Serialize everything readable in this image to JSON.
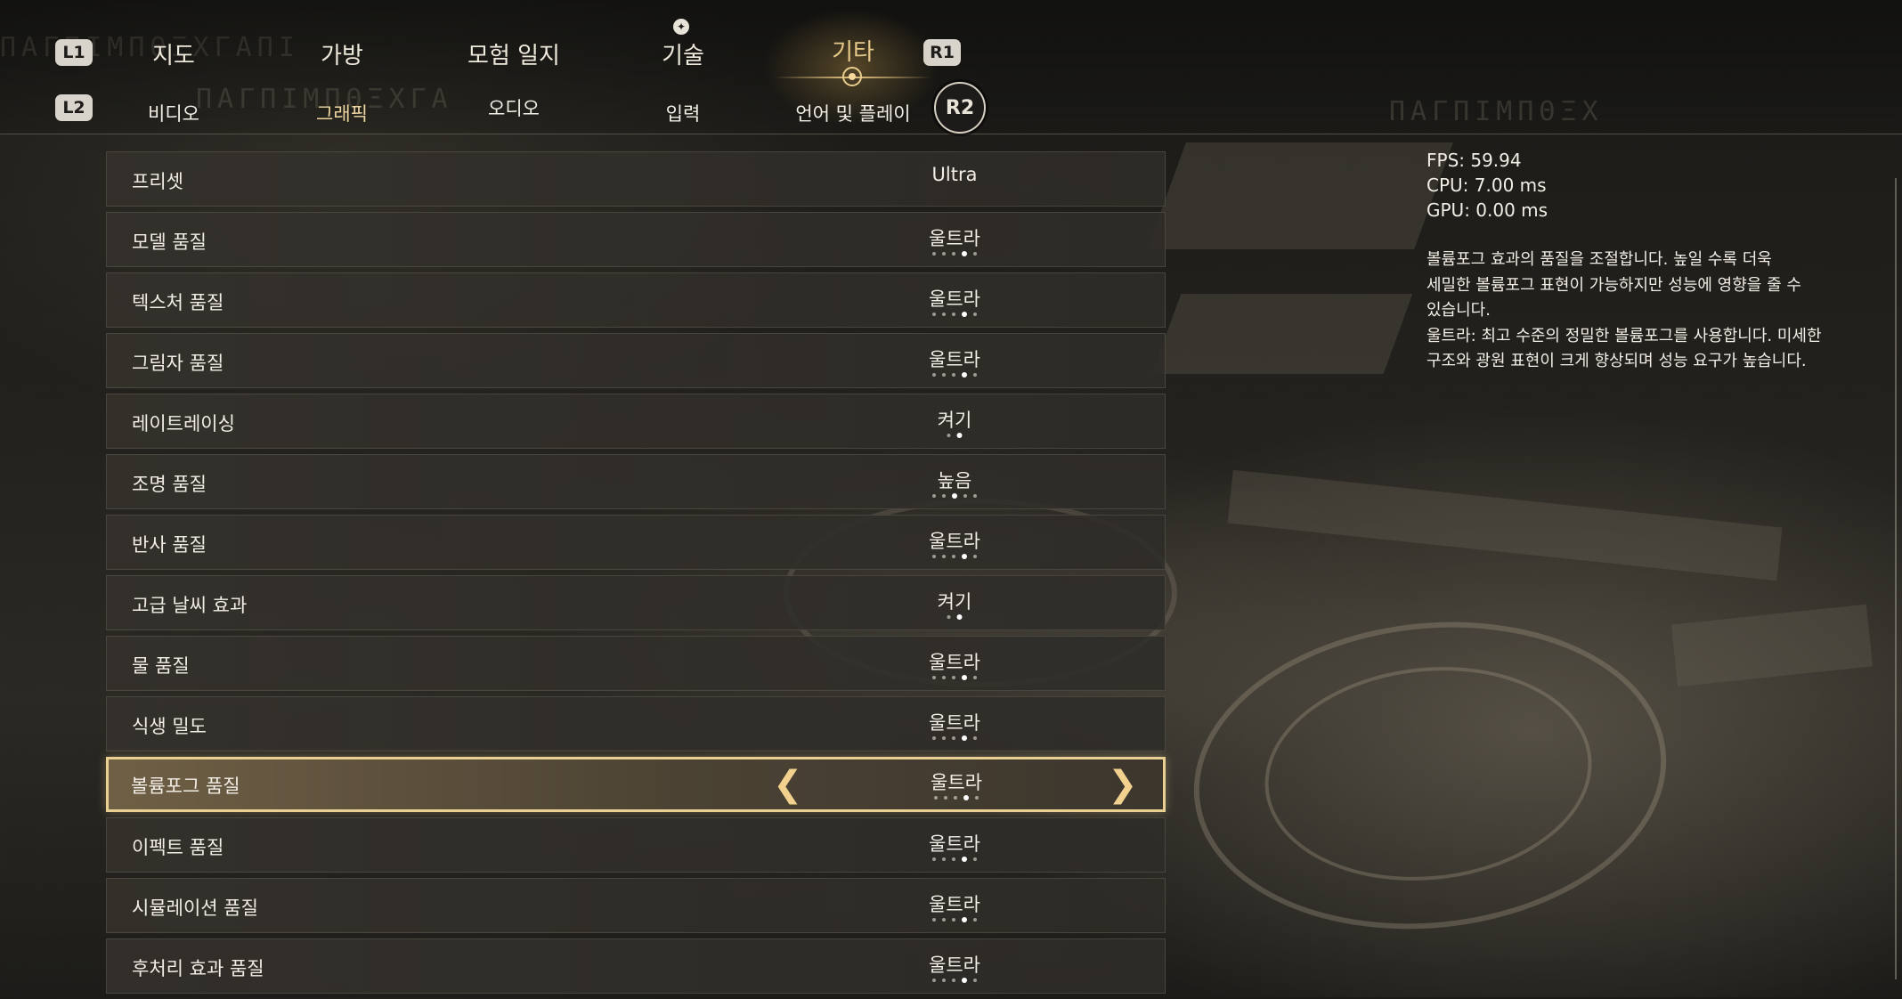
{
  "nav": {
    "l1": "L1",
    "r1": "R1",
    "l2": "L2",
    "r2": "R2",
    "main_tabs": [
      {
        "label": "지도"
      },
      {
        "label": "가방"
      },
      {
        "label": "모험 일지"
      },
      {
        "label": "기술"
      },
      {
        "label": "기타"
      }
    ],
    "sub_tabs": [
      {
        "label": "비디오"
      },
      {
        "label": "그래픽"
      },
      {
        "label": "오디오"
      },
      {
        "label": "입력"
      },
      {
        "label": "언어 및 플레이"
      }
    ],
    "active_main_tab": "기타",
    "active_sub_tab": "그래픽",
    "accent_color": "#e9cf92"
  },
  "settings": [
    {
      "label": "프리셋",
      "value": "Ultra"
    },
    {
      "label": "모델 품질",
      "value": "울트라"
    },
    {
      "label": "텍스처 품질",
      "value": "울트라"
    },
    {
      "label": "그림자 품질",
      "value": "울트라"
    },
    {
      "label": "레이트레이싱",
      "value": "켜기"
    },
    {
      "label": "조명 품질",
      "value": "높음"
    },
    {
      "label": "반사 품질",
      "value": "울트라"
    },
    {
      "label": "고급 날씨 효과",
      "value": "켜기"
    },
    {
      "label": "물 품질",
      "value": "울트라"
    },
    {
      "label": "식생 밀도",
      "value": "울트라"
    },
    {
      "label": "볼륨포그 품질",
      "value": "울트라"
    },
    {
      "label": "이펙트 품질",
      "value": "울트라"
    },
    {
      "label": "시뮬레이션 품질",
      "value": "울트라"
    },
    {
      "label": "후처리 효과 품질",
      "value": "울트라"
    }
  ],
  "selected_setting": "볼륨포그 품질",
  "stats": {
    "fps": "FPS: 59.94",
    "cpu": "CPU: 7.00 ms",
    "gpu": "GPU: 0.00 ms"
  },
  "description": {
    "line1": "볼륨포그 효과의 품질을 조절합니다. 높일 수록 더욱",
    "line2": "세밀한 볼륨포그 표현이 가능하지만 성능에 영향을 줄 수",
    "line3": "있습니다.",
    "line4": "울트라: 최고 수준의 정밀한 볼륨포그를 사용합니다. 미세한",
    "line5": "구조와 광원 표현이 크게 향상되며 성능 요구가 높습니다."
  }
}
